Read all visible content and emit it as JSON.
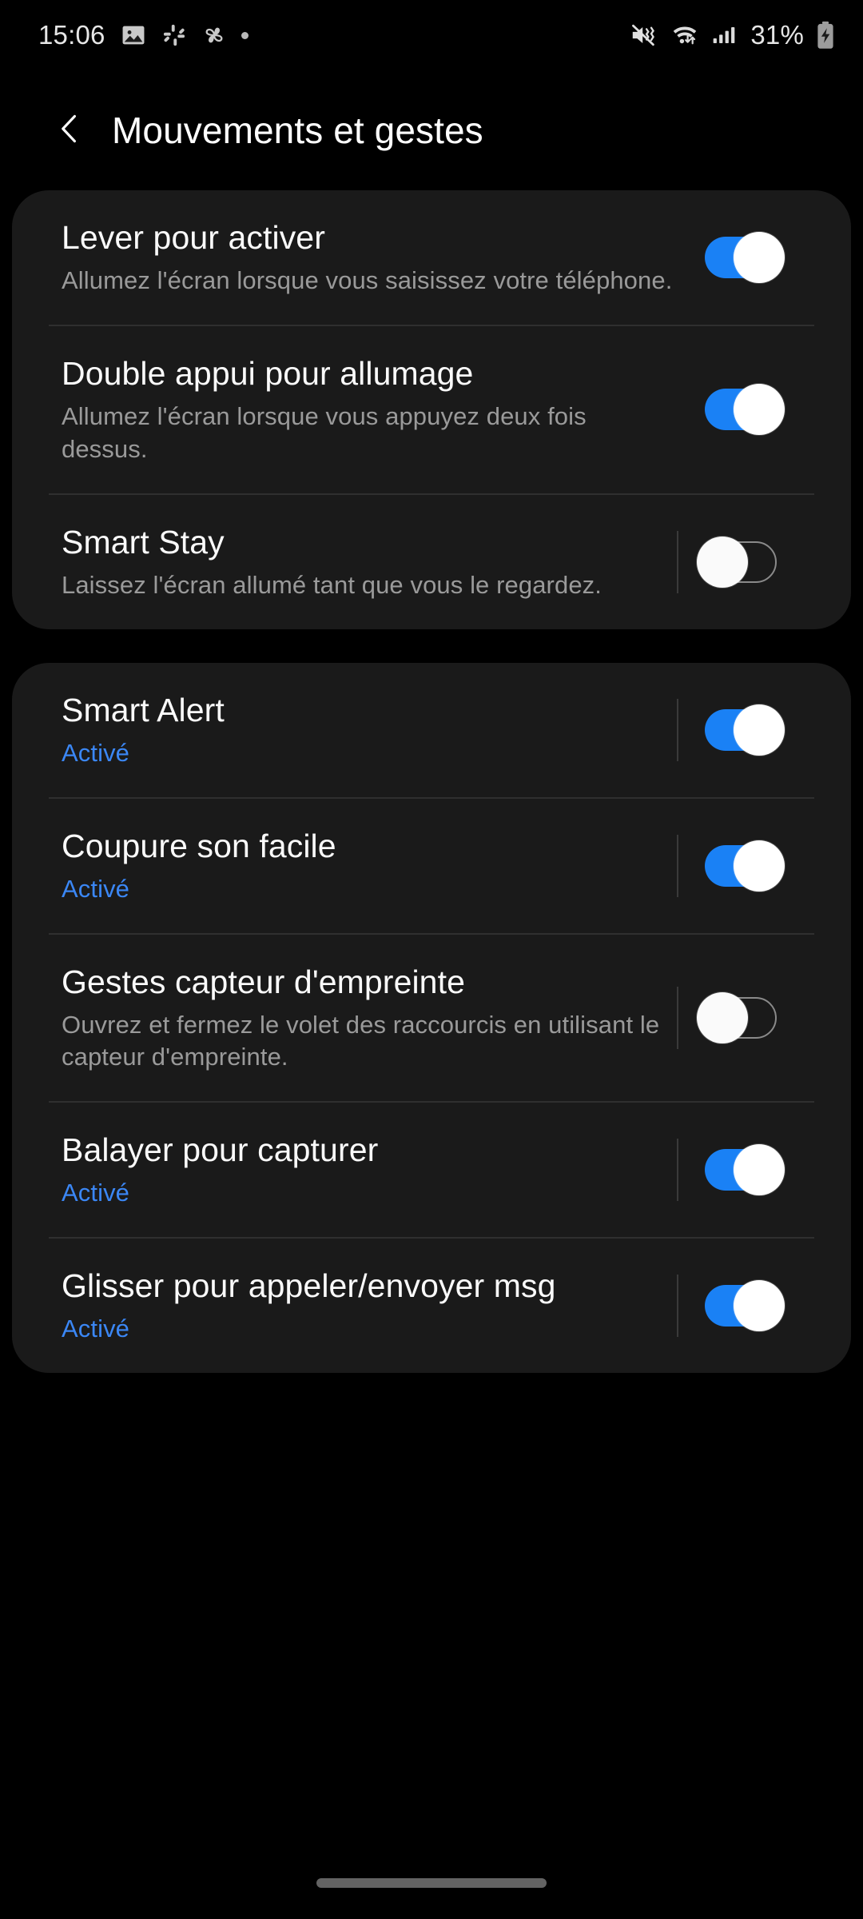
{
  "status_bar": {
    "time": "15:06",
    "battery_percent": "31%",
    "left_icons": [
      "image-icon",
      "slack-icon",
      "pinwheel-icon",
      "dot-icon"
    ],
    "right_icons": [
      "mute-vibrate-icon",
      "wifi-icon",
      "signal-bars-icon",
      "battery-charging-icon"
    ]
  },
  "header": {
    "back_icon": "chevron-left-icon",
    "title": "Mouvements et gestes"
  },
  "colors": {
    "accent": "#3b87f5",
    "toggle_on": "#1a81f5",
    "card_bg": "#1a1a1a",
    "page_bg": "#000000",
    "title_text": "#fafafa",
    "sub_text": "#9a9a9a"
  },
  "groups": [
    {
      "name": "screen-gestures-group",
      "rows": [
        {
          "name": "lever-pour-activer",
          "title": "Lever pour activer",
          "subtitle": "Allumez l'écran lorsque vous saisissez votre téléphone.",
          "subtitle_accent": false,
          "toggle": "on",
          "divider": false
        },
        {
          "name": "double-appui-pour-allumage",
          "title": "Double appui pour allumage",
          "subtitle": "Allumez l'écran lorsque vous appuyez deux fois dessus.",
          "subtitle_accent": false,
          "toggle": "on",
          "divider": false
        },
        {
          "name": "smart-stay",
          "title": "Smart Stay",
          "subtitle": "Laissez l'écran allumé tant que vous le regardez.",
          "subtitle_accent": false,
          "toggle": "off",
          "divider": true
        }
      ]
    },
    {
      "name": "motion-gestures-group",
      "rows": [
        {
          "name": "smart-alert",
          "title": "Smart Alert",
          "subtitle": "Activé",
          "subtitle_accent": true,
          "toggle": "on",
          "divider": true
        },
        {
          "name": "coupure-son-facile",
          "title": "Coupure son facile",
          "subtitle": "Activé",
          "subtitle_accent": true,
          "toggle": "on",
          "divider": true
        },
        {
          "name": "gestes-capteur-empreinte",
          "title": "Gestes capteur d'empreinte",
          "subtitle": "Ouvrez et fermez le volet des raccourcis en utilisant le capteur d'empreinte.",
          "subtitle_accent": false,
          "toggle": "off",
          "divider": true
        },
        {
          "name": "balayer-pour-capturer",
          "title": "Balayer pour capturer",
          "subtitle": "Activé",
          "subtitle_accent": true,
          "toggle": "on",
          "divider": true
        },
        {
          "name": "glisser-pour-appeler-envoyer-msg",
          "title": "Glisser pour appeler/envoyer msg",
          "subtitle": "Activé",
          "subtitle_accent": true,
          "toggle": "on",
          "divider": true
        }
      ]
    }
  ],
  "navigation_bar": {
    "gesture_pill": "home-gesture-pill"
  }
}
